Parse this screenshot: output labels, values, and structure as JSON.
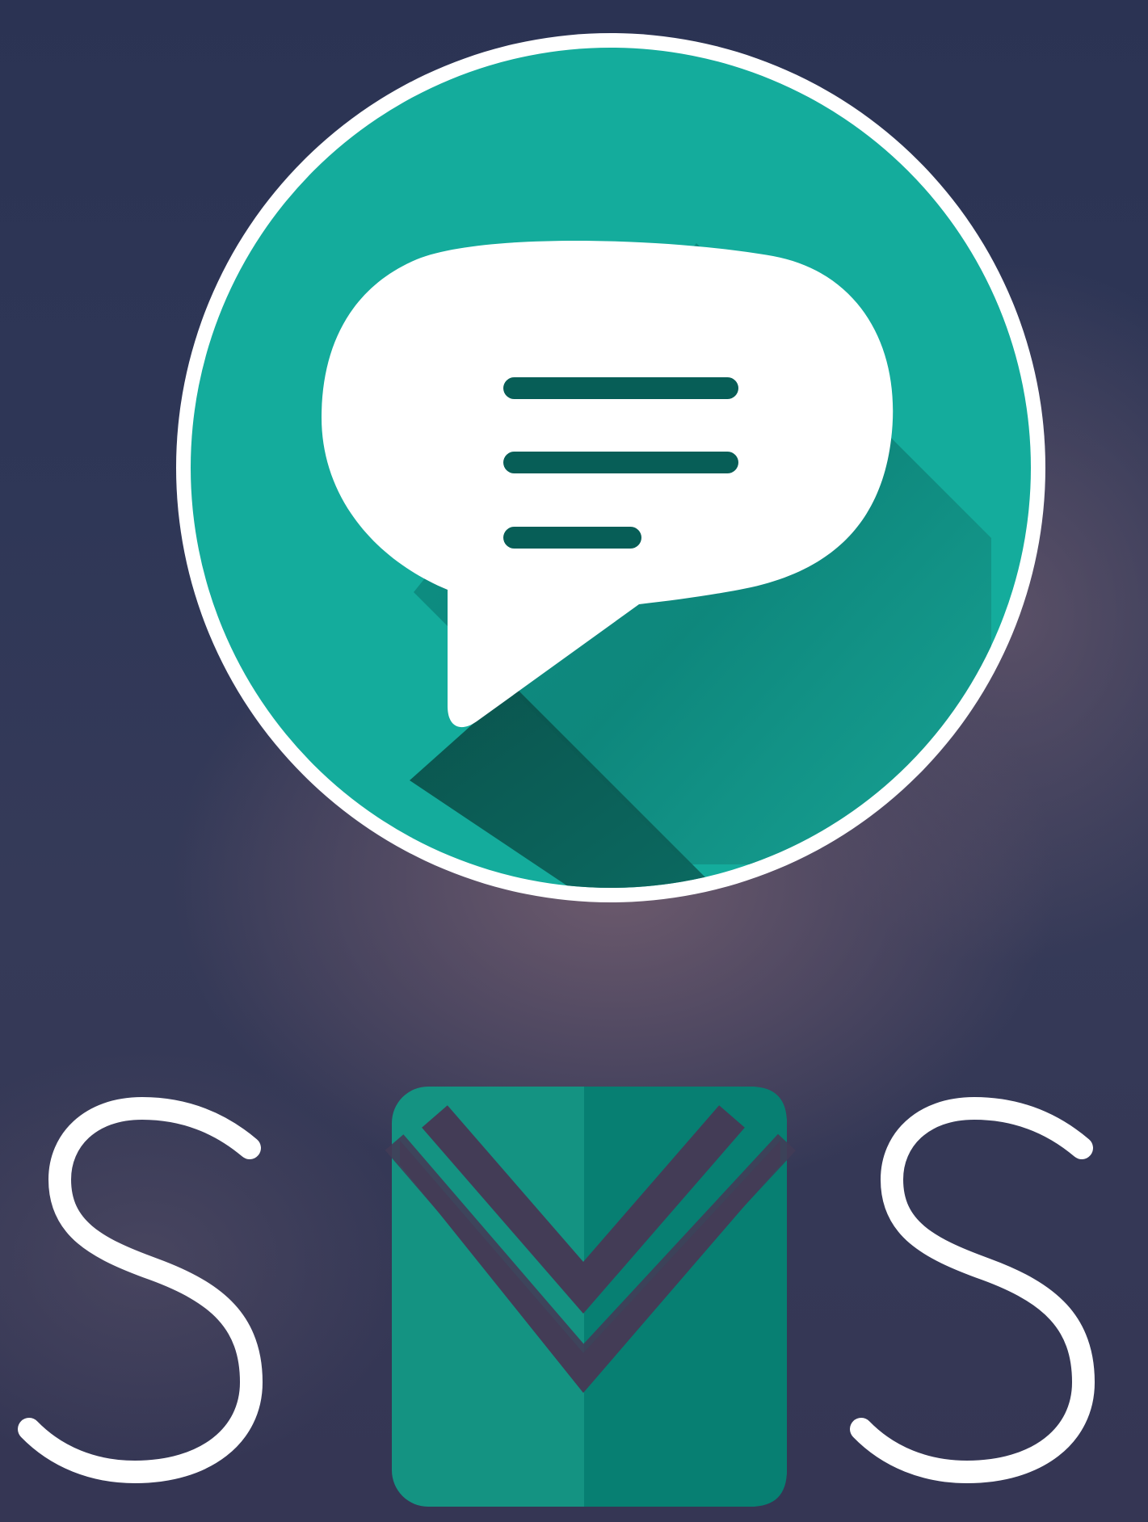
{
  "logo": {
    "title": "SMS",
    "letters": [
      "S",
      "S"
    ],
    "icon_names": [
      "message-bubble-icon",
      "envelope-icon"
    ]
  },
  "colors": {
    "background": "#2c3452",
    "teal": "#14ac9c",
    "deep_teal": "#0a7a70",
    "white": "#ffffff"
  }
}
